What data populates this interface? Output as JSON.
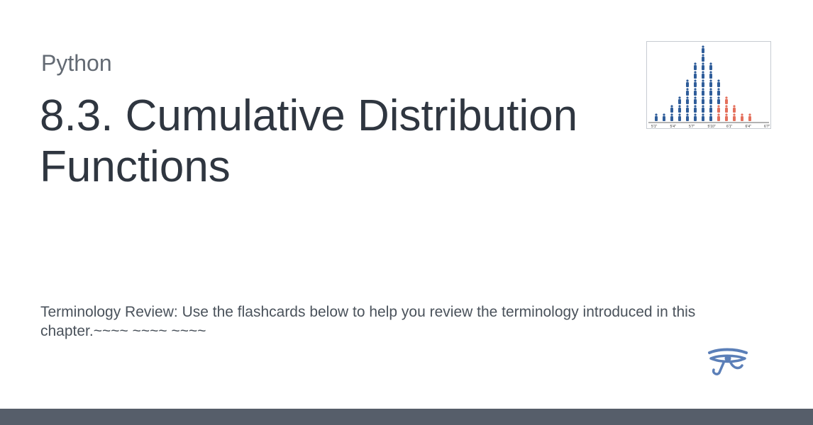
{
  "section": {
    "label": "Python"
  },
  "title": "8.3. Cumulative Distribution Functions",
  "description": "Terminology Review: Use the flashcards below to help you review the terminology introduced in this chapter.~~~~ ~~~~ ~~~~",
  "thumbnail": {
    "axis_labels": [
      "5'1\"",
      "5'4\"",
      "5'7\"",
      "5'10\"",
      "6'1\"",
      "6'4\"",
      "6'7\""
    ],
    "colors": {
      "blue": "#2f5d9a",
      "red": "#e4705c"
    }
  },
  "logo": {
    "icon": "eye-of-horus-icon",
    "color": "#5b7fb8"
  },
  "colors": {
    "footer": "#565e6a",
    "title": "#2f3640",
    "muted": "#636a73"
  }
}
